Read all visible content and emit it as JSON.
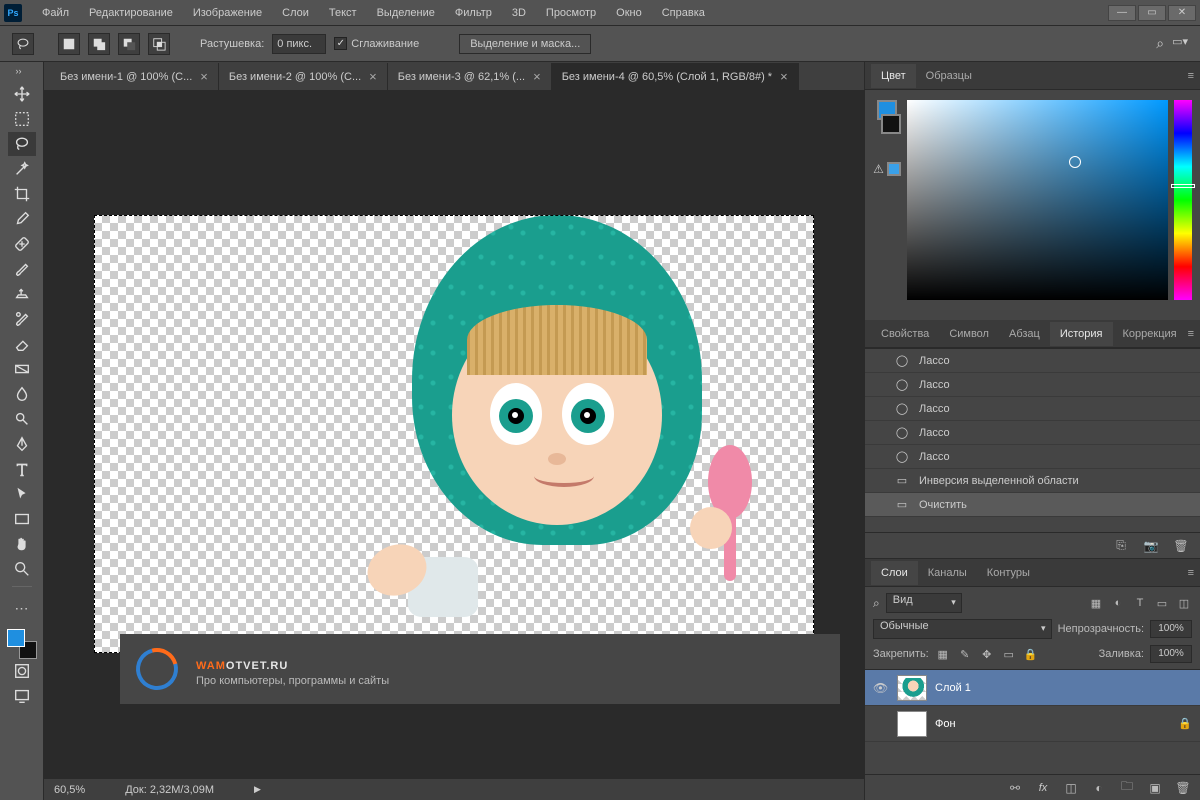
{
  "menu": [
    "Файл",
    "Редактирование",
    "Изображение",
    "Слои",
    "Текст",
    "Выделение",
    "Фильтр",
    "3D",
    "Просмотр",
    "Окно",
    "Справка"
  ],
  "options": {
    "feather_label": "Растушевка:",
    "feather_value": "0 пикс.",
    "antialias": "Сглаживание",
    "refine": "Выделение и маска..."
  },
  "tabs": [
    {
      "label": "Без имени-1 @ 100% (С...",
      "active": false
    },
    {
      "label": "Без имени-2 @ 100% (С...",
      "active": false
    },
    {
      "label": "Без имени-3 @ 62,1% (...",
      "active": false
    },
    {
      "label": "Без имени-4 @ 60,5% (Слой 1, RGB/8#) *",
      "active": true
    }
  ],
  "status": {
    "zoom": "60,5%",
    "doc": "Док: 2,32M/3,09M"
  },
  "overlay": {
    "title_w": "WAM",
    "title_rest": "OTVET.RU",
    "sub": "Про компьютеры, программы и сайты"
  },
  "panel_color": {
    "tabs": [
      "Цвет",
      "Образцы"
    ],
    "fg": "#1f8fe0",
    "bg": "#111111",
    "small": "#3aa0e8"
  },
  "panel_props": {
    "tabs": [
      "Свойства",
      "Символ",
      "Абзац",
      "История",
      "Коррекция"
    ],
    "active": 3
  },
  "history": [
    {
      "label": "Лассо",
      "icon": "lasso"
    },
    {
      "label": "Лассо",
      "icon": "lasso"
    },
    {
      "label": "Лассо",
      "icon": "lasso"
    },
    {
      "label": "Лассо",
      "icon": "lasso"
    },
    {
      "label": "Лассо",
      "icon": "lasso"
    },
    {
      "label": "Инверсия выделенной области",
      "icon": "rect"
    },
    {
      "label": "Очистить",
      "icon": "rect",
      "active": true
    }
  ],
  "panel_layers": {
    "tabs": [
      "Слои",
      "Каналы",
      "Контуры"
    ],
    "filter": "Вид",
    "blend": "Обычные",
    "opacity_label": "Непрозрачность:",
    "opacity": "100%",
    "lock_label": "Закрепить:",
    "fill_label": "Заливка:",
    "fill": "100%",
    "layers": [
      {
        "name": "Слой 1",
        "visible": true,
        "active": true
      },
      {
        "name": "Фон",
        "visible": false,
        "locked": true
      }
    ]
  },
  "colors": {
    "fg": "#1f8fe0"
  }
}
